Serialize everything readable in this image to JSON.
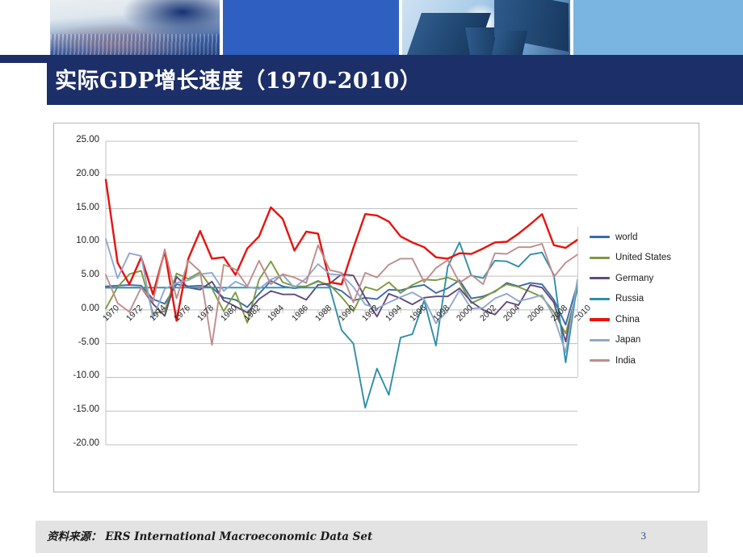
{
  "slide": {
    "title": "实际GDP增长速度（1970-2010）",
    "page_number": "3"
  },
  "header": {
    "segments": [
      {
        "name": "photo-hands-keyboard"
      },
      {
        "name": "solid-blue-panel"
      },
      {
        "name": "photo-skyscrapers"
      },
      {
        "name": "light-blue-panel"
      }
    ]
  },
  "footer": {
    "source_label": "资料来源：",
    "source_value": "ERS International Macroeconomic  Data Set",
    "full_text": "资料来源： ERS International Macroeconomic  Data Set"
  },
  "legend": {
    "position": "right",
    "entries": [
      {
        "label": "world",
        "color": "#3A6BA5"
      },
      {
        "label": "United States",
        "color": "#7D9A3E"
      },
      {
        "label": "Germany",
        "color": "#604A7B"
      },
      {
        "label": "Russia",
        "color": "#2E8FA8"
      },
      {
        "label": "China",
        "color": "#E8120C"
      },
      {
        "label": "Japan",
        "color": "#8FA8CE"
      },
      {
        "label": "India",
        "color": "#C08C8C"
      }
    ]
  },
  "chart_data": {
    "type": "line",
    "title": "实际GDP增长速度（1970-2010）",
    "xlabel": "",
    "ylabel": "",
    "grid": true,
    "legend_position": "right",
    "ylim": [
      -20.0,
      25.0
    ],
    "ytick_labels": [
      "25.00",
      "20.00",
      "15.00",
      "10.00",
      "5.00",
      "0.00",
      "-5.00",
      "-10.00",
      "-15.00",
      "-20.00"
    ],
    "yticks": [
      25,
      20,
      15,
      10,
      5,
      0,
      -5,
      -10,
      -15,
      -20
    ],
    "xlim": [
      1970,
      2010
    ],
    "xtick_labels": [
      "1970",
      "1972",
      "1974",
      "1976",
      "1978",
      "1980",
      "1982",
      "1984",
      "1986",
      "1988",
      "1990",
      "1992",
      "1994",
      "1996",
      "1998",
      "2000",
      "2002",
      "2004",
      "2006",
      "2008",
      "2010"
    ],
    "x": [
      1970,
      1971,
      1972,
      1973,
      1974,
      1975,
      1976,
      1977,
      1978,
      1979,
      1980,
      1981,
      1982,
      1983,
      1984,
      1985,
      1986,
      1987,
      1988,
      1989,
      1990,
      1991,
      1992,
      1993,
      1994,
      1995,
      1996,
      1997,
      1998,
      1999,
      2000,
      2001,
      2002,
      2003,
      2004,
      2005,
      2006,
      2007,
      2008,
      2009,
      2010
    ],
    "series": [
      {
        "name": "world",
        "color": "#3A6BA5",
        "values": [
          3.5,
          3.6,
          3.7,
          3.6,
          1.6,
          0.9,
          3.8,
          3.5,
          3.6,
          3.3,
          1.8,
          1.5,
          0.4,
          2.4,
          4.3,
          3.5,
          3.2,
          3.5,
          4.3,
          3.5,
          2.8,
          1.4,
          1.8,
          1.6,
          3.0,
          2.9,
          3.4,
          3.7,
          2.5,
          3.2,
          4.4,
          1.7,
          2.0,
          2.7,
          4.0,
          3.5,
          4.0,
          3.8,
          1.5,
          -2.2,
          3.9
        ]
      },
      {
        "name": "United States",
        "color": "#7D9A3E",
        "values": [
          0.2,
          3.4,
          5.3,
          5.8,
          -0.5,
          -0.2,
          5.4,
          4.6,
          5.6,
          3.2,
          -0.2,
          2.6,
          -1.9,
          4.5,
          7.2,
          4.1,
          3.5,
          3.5,
          4.2,
          3.7,
          1.9,
          -0.2,
          3.4,
          2.9,
          4.1,
          2.5,
          3.7,
          4.5,
          4.4,
          4.8,
          4.1,
          1.0,
          1.8,
          2.8,
          3.8,
          3.4,
          2.7,
          1.9,
          -0.3,
          -3.5,
          3.0
        ]
      },
      {
        "name": "Germany",
        "color": "#604A7B",
        "values": [
          3.3,
          3.3,
          3.3,
          3.3,
          0.9,
          -0.9,
          4.9,
          3.3,
          3.0,
          4.2,
          1.4,
          0.5,
          -0.4,
          1.6,
          2.8,
          2.3,
          2.3,
          1.5,
          3.7,
          3.9,
          5.3,
          5.1,
          1.8,
          -1.0,
          2.4,
          1.7,
          0.8,
          1.8,
          2.0,
          2.0,
          3.2,
          1.2,
          0.0,
          -0.7,
          1.2,
          0.7,
          3.7,
          3.3,
          1.1,
          -4.7,
          3.6
        ]
      },
      {
        "name": "Russia",
        "color": "#2E8FA8",
        "values": [
          3.3,
          3.3,
          3.3,
          3.3,
          3.3,
          3.3,
          3.3,
          3.3,
          3.3,
          3.3,
          3.3,
          3.3,
          3.3,
          3.3,
          3.3,
          3.3,
          3.3,
          3.3,
          3.3,
          3.3,
          -3.0,
          -5.0,
          -14.5,
          -8.7,
          -12.6,
          -4.1,
          -3.6,
          1.4,
          -5.3,
          6.4,
          10.0,
          5.1,
          4.7,
          7.3,
          7.2,
          6.4,
          8.2,
          8.5,
          5.2,
          -7.8,
          4.0
        ]
      },
      {
        "name": "China",
        "color": "#E8120C",
        "values": [
          19.3,
          7.0,
          3.8,
          7.8,
          2.3,
          8.7,
          -1.6,
          7.6,
          11.7,
          7.6,
          7.8,
          5.2,
          9.1,
          10.9,
          15.2,
          13.5,
          8.8,
          11.6,
          11.3,
          4.1,
          3.8,
          9.2,
          14.2,
          14.0,
          13.1,
          10.9,
          10.0,
          9.3,
          7.8,
          7.6,
          8.4,
          8.3,
          9.1,
          10.0,
          10.1,
          11.3,
          12.7,
          14.2,
          9.6,
          9.2,
          10.4
        ]
      },
      {
        "name": "Japan",
        "color": "#8FA8CE",
        "values": [
          10.5,
          4.7,
          8.4,
          8.0,
          -1.2,
          3.1,
          4.0,
          4.4,
          5.3,
          5.5,
          2.8,
          4.2,
          3.4,
          3.1,
          4.5,
          5.2,
          3.3,
          4.7,
          6.8,
          5.3,
          5.2,
          3.4,
          0.8,
          0.2,
          1.1,
          1.9,
          2.6,
          1.6,
          -2.0,
          -0.1,
          2.9,
          0.2,
          0.3,
          1.7,
          2.4,
          1.3,
          1.7,
          2.2,
          -1.0,
          -6.3,
          4.5
        ]
      },
      {
        "name": "India",
        "color": "#C08C8C",
        "values": [
          5.2,
          1.0,
          -0.3,
          3.3,
          1.2,
          9.0,
          1.7,
          7.3,
          5.7,
          -5.2,
          6.7,
          6.0,
          3.5,
          7.3,
          3.8,
          5.3,
          4.8,
          4.0,
          9.6,
          5.9,
          5.5,
          1.1,
          5.5,
          4.8,
          6.7,
          7.6,
          7.6,
          4.1,
          6.2,
          7.4,
          4.0,
          5.2,
          3.8,
          8.4,
          8.3,
          9.3,
          9.3,
          9.8,
          4.9,
          7.0,
          8.2
        ]
      }
    ]
  }
}
